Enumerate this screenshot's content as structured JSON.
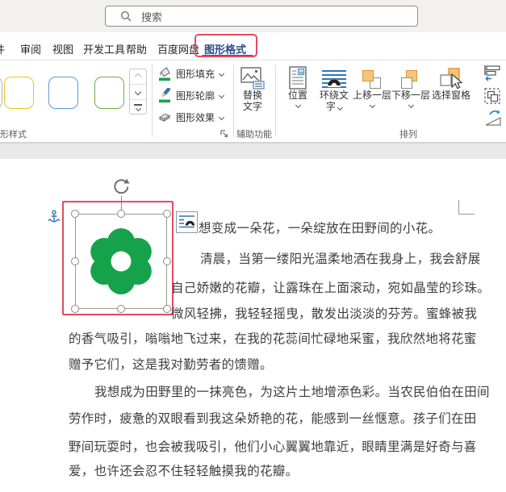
{
  "colors": {
    "flower_green": "#15a24b",
    "ribbon_green_bar": "#18a24d",
    "annotation_red": "#e34a62",
    "active_tab_blue": "#2b4a8c",
    "wrap_blue": "#2e75b6",
    "layer_orange": "#f6c476",
    "style_yellow": "#eec324",
    "style_blue": "#5b9bd5",
    "style_green": "#70ad47"
  },
  "titlebar": {
    "search_placeholder": "搜索"
  },
  "tab_bar": {
    "tabs": [
      {
        "label": "件"
      },
      {
        "label": "审阅"
      },
      {
        "label": "视图"
      },
      {
        "label": "开发工具"
      },
      {
        "label": "帮助"
      },
      {
        "label": "百度网盘"
      },
      {
        "label": "图形格式"
      }
    ],
    "active_tab": "图形格式"
  },
  "ribbon": {
    "shape_styles": {
      "group_label": "形样式",
      "fill_label": "图形填充",
      "outline_label": "图形轮廓",
      "effects_label": "图形效果"
    },
    "accessibility": {
      "group_label": "辅助功能",
      "alt_text_line1": "替换",
      "alt_text_line2": "文字"
    },
    "arrange": {
      "group_label": "排列",
      "position_label": "位置",
      "wrap_line1": "环绕文",
      "wrap_line2": "字",
      "bring_forward_label": "上移一层",
      "send_backward_label": "下移一层",
      "selection_pane_label": "选择窗格"
    }
  },
  "document": {
    "lines": [
      "想变成一朵花，一朵绽放在田野间的小花。",
      "清晨，当第一缕阳光温柔地洒在我身上，我会舒展",
      "自己娇嫩的花瓣，让露珠在上面滚动，宛如晶莹的珍珠。",
      "微风轻拂，我轻轻摇曳，散发出淡淡的芬芳。蜜蜂被我",
      "的香气吸引，嗡嗡地飞过来，在我的花蕊间忙碌地采蜜，我欣然地将花蜜",
      "赠予它们，这是我对勤劳者的馈赠。",
      "我想成为田野里的一抹亮色，为这片土地增添色彩。当农民伯伯在田间",
      "劳作时，疲惫的双眼看到我这朵娇艳的花，能感到一丝惬意。孩子们在田",
      "野间玩耍时，也会被我吸引，他们小心翼翼地靠近，眼睛里满是好奇与喜",
      "爱，也许还会忍不住轻轻触摸我的花瓣。"
    ]
  }
}
